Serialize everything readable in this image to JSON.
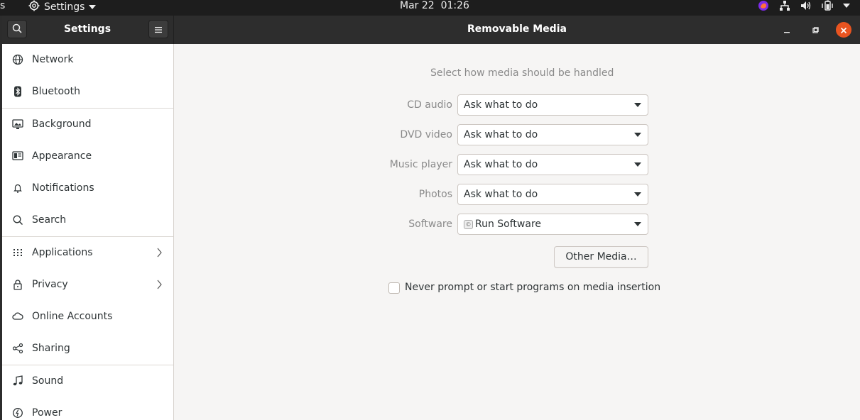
{
  "topbar": {
    "activities_label": "s",
    "app_name": "Settings",
    "clock": "Mar 22  01:26"
  },
  "window": {
    "sidebar_title": "Settings",
    "page_title": "Removable Media"
  },
  "sidebar": {
    "items": [
      {
        "label": "Network",
        "icon": "network-icon"
      },
      {
        "label": "Bluetooth",
        "icon": "bluetooth-icon"
      },
      {
        "label": "Background",
        "icon": "background-icon"
      },
      {
        "label": "Appearance",
        "icon": "appearance-icon"
      },
      {
        "label": "Notifications",
        "icon": "bell-icon"
      },
      {
        "label": "Search",
        "icon": "search-icon"
      },
      {
        "label": "Applications",
        "icon": "grid-icon"
      },
      {
        "label": "Privacy",
        "icon": "lock-icon"
      },
      {
        "label": "Online Accounts",
        "icon": "cloud-icon"
      },
      {
        "label": "Sharing",
        "icon": "share-icon"
      },
      {
        "label": "Sound",
        "icon": "music-note-icon"
      },
      {
        "label": "Power",
        "icon": "power-icon"
      }
    ]
  },
  "main": {
    "heading": "Select how media should be handled",
    "rows": [
      {
        "label": "CD audio",
        "value": "Ask what to do"
      },
      {
        "label": "DVD video",
        "value": "Ask what to do"
      },
      {
        "label": "Music player",
        "value": "Ask what to do"
      },
      {
        "label": "Photos",
        "value": "Ask what to do"
      },
      {
        "label": "Software",
        "value": "Run Software"
      }
    ],
    "other_media_button": "Other Media…",
    "never_prompt_label": "Never prompt or start programs on media insertion",
    "never_prompt_checked": false
  },
  "colors": {
    "accent": "#e95420",
    "headerbar": "#2d2d2d",
    "topbar": "#1d1d1d",
    "content_bg": "#f6f5f4"
  }
}
